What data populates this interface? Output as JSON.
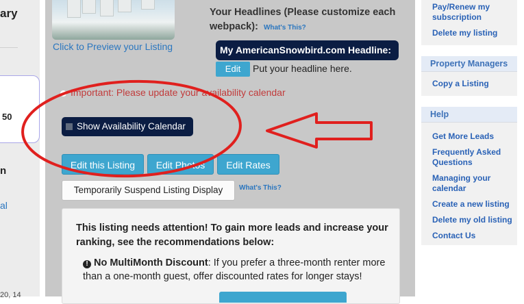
{
  "left": {
    "title_fragment": "ary",
    "number": "50",
    "letter": "n",
    "link_fragment": "al",
    "date_fragment": "20, 14"
  },
  "listing": {
    "preview_link": "Click to Preview your Listing",
    "headlines_title": "Your Headlines (Please customize each webpack):",
    "whats_this": "What's This?",
    "headline_bar": "My AmericanSnowbird.com Headline:",
    "edit_label": "Edit",
    "headline_placeholder": "Put your headline here.",
    "important_text": "Important: Please update your availability calendar",
    "calendar_button": "Show Availability Calendar",
    "edit_listing": "Edit this Listing",
    "edit_photos": "Edit Photos",
    "edit_rates": "Edit Rates",
    "suspend_button": "Temporarily Suspend Listing Display",
    "suspend_whats_this": "What's This?"
  },
  "attention": {
    "title": "This listing needs attention! To gain more leads and increase your ranking, see the recommendations below:",
    "item_bold": "No MultiMonth Discount",
    "item_text": ": If you prefer a three-month renter more than a one-month guest, offer discounted rates for longer stays!"
  },
  "sidebar": {
    "account_links": [
      "Pay/Renew my subscription",
      "Delete my listing"
    ],
    "property_managers_header": "Property Managers",
    "property_managers_links": [
      "Copy a Listing"
    ],
    "help_header": "Help",
    "help_links": [
      "Get More Leads",
      "Frequently Asked Questions",
      "Managing your calendar",
      "Create a new listing",
      "Delete my old listing",
      "Contact Us"
    ]
  },
  "colors": {
    "annotation_red": "#e0201e",
    "navy": "#0b1d43",
    "button_blue": "#3ea6cf",
    "link_blue": "#2a76bf"
  }
}
